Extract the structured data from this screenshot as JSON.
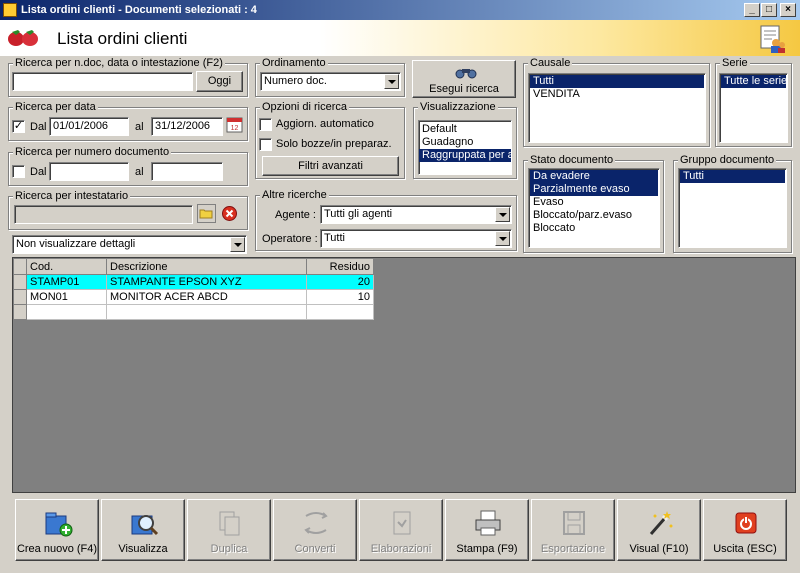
{
  "window": {
    "title": "Lista ordini clienti - Documenti selezionati : 4",
    "minimize": "_",
    "maximize": "□",
    "close": "×"
  },
  "header": {
    "title": "Lista ordini clienti"
  },
  "search_ndoc": {
    "label": "Ricerca per n.doc, data o intestazione (F2)",
    "value": "",
    "button": "Oggi"
  },
  "search_date": {
    "label": "Ricerca per data",
    "checked": "✓",
    "from_label": "Dal",
    "from_value": "01/01/2006",
    "to_label": "al",
    "to_value": "31/12/2006"
  },
  "search_number": {
    "label": "Ricerca per numero documento",
    "from_label": "Dal",
    "from_value": "",
    "to_label": "al",
    "to_value": ""
  },
  "search_holder": {
    "label": "Ricerca per intestatario",
    "value": ""
  },
  "details_select": {
    "value": "Non visualizzare dettagli"
  },
  "ordering": {
    "label": "Ordinamento",
    "value": "Numero doc."
  },
  "search_button": {
    "label": "Esegui ricerca"
  },
  "search_options": {
    "label": "Opzioni di ricerca",
    "auto_update": "Aggiorn. automatico",
    "drafts_only": "Solo bozze/in preparaz.",
    "advanced_filters": "Filtri avanzati"
  },
  "view": {
    "label": "Visualizzazione",
    "items": [
      "Default",
      "Guadagno",
      "Raggruppata per a"
    ]
  },
  "other_search": {
    "label": "Altre ricerche",
    "agent_label": "Agente :",
    "agent_value": "Tutti gli agenti",
    "operator_label": "Operatore :",
    "operator_value": "Tutti"
  },
  "causale": {
    "label": "Causale",
    "items": [
      "Tutti",
      "VENDITA"
    ]
  },
  "serie": {
    "label": "Serie",
    "items": [
      "Tutte le serie"
    ]
  },
  "doc_state": {
    "label": "Stato documento",
    "items": [
      "Da evadere",
      "Parzialmente evaso",
      "Evaso",
      "Bloccato/parz.evaso",
      "Bloccato"
    ]
  },
  "doc_group": {
    "label": "Gruppo documento",
    "items": [
      "Tutti"
    ]
  },
  "grid": {
    "columns": [
      "Cod.",
      "Descrizione",
      "Residuo"
    ],
    "rows": [
      {
        "code": "STAMP01",
        "desc": "STAMPANTE EPSON XYZ",
        "residuo": "20"
      },
      {
        "code": "MON01",
        "desc": "MONITOR ACER ABCD",
        "residuo": "10"
      }
    ]
  },
  "toolbar": {
    "new": "Crea nuovo (F4)",
    "view": "Visualizza",
    "duplicate": "Duplica",
    "convert": "Converti",
    "processing": "Elaborazioni",
    "print": "Stampa (F9)",
    "export": "Esportazione",
    "visual": "Visual (F10)",
    "exit": "Uscita (ESC)"
  }
}
